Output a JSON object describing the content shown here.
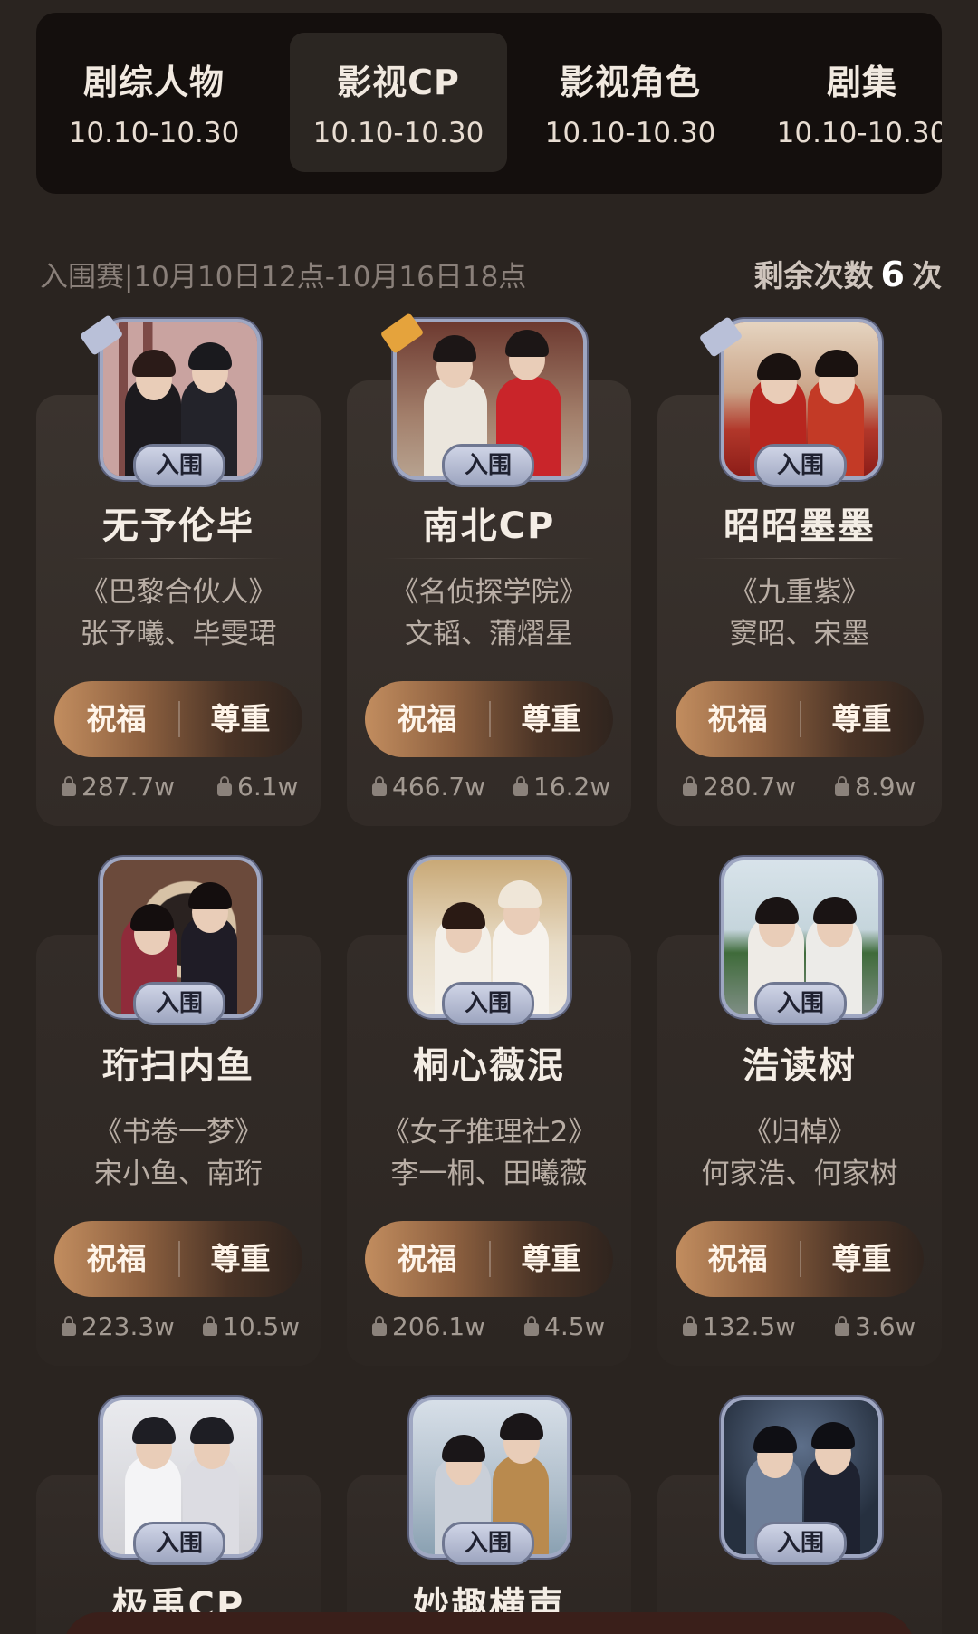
{
  "tabs": [
    {
      "title": "剧综人物",
      "date": "10.10-10.30",
      "active": false
    },
    {
      "title": "影视CP",
      "date": "10.10-10.30",
      "active": true
    },
    {
      "title": "影视角色",
      "date": "10.10-10.30",
      "active": false
    },
    {
      "title": "剧集",
      "date": "10.10-10.30",
      "active": false
    }
  ],
  "info": {
    "stage": "入围赛|10月10日12点-10月16日18点",
    "remaining_label": "剩余次数",
    "remaining_count": "6",
    "remaining_unit": "次"
  },
  "badge_label": "入围",
  "buttons": {
    "bless": "祝福",
    "respect": "尊重"
  },
  "cards": [
    {
      "name": "无予伦毕",
      "show": "《巴黎合伙人》",
      "actors": "张予曦、毕雯珺",
      "bless_count": "287.7w",
      "respect_count": "6.1w"
    },
    {
      "name": "南北CP",
      "show": "《名侦探学院》",
      "actors": "文韬、蒲熠星",
      "bless_count": "466.7w",
      "respect_count": "16.2w"
    },
    {
      "name": "昭昭墨墨",
      "show": "《九重紫》",
      "actors": "窦昭、宋墨",
      "bless_count": "280.7w",
      "respect_count": "8.9w"
    },
    {
      "name": "珩扫内鱼",
      "show": "《书卷一梦》",
      "actors": "宋小鱼、南珩",
      "bless_count": "223.3w",
      "respect_count": "10.5w"
    },
    {
      "name": "桐心薇泯",
      "show": "《女子推理社2》",
      "actors": "李一桐、田曦薇",
      "bless_count": "206.1w",
      "respect_count": "4.5w"
    },
    {
      "name": "浩读树",
      "show": "《归棹》",
      "actors": "何家浩、何家树",
      "bless_count": "132.5w",
      "respect_count": "3.6w"
    },
    {
      "name": "极禹CP"
    },
    {
      "name": "妙趣横声"
    },
    {
      "name": ""
    }
  ],
  "colors": {
    "background": "#2a2420",
    "tabbar": "#140f0d",
    "card": "#3a332e",
    "badge": "#b5bcd4",
    "button_gradient_start": "#c28d5f",
    "button_gradient_end": "#2f241e"
  }
}
